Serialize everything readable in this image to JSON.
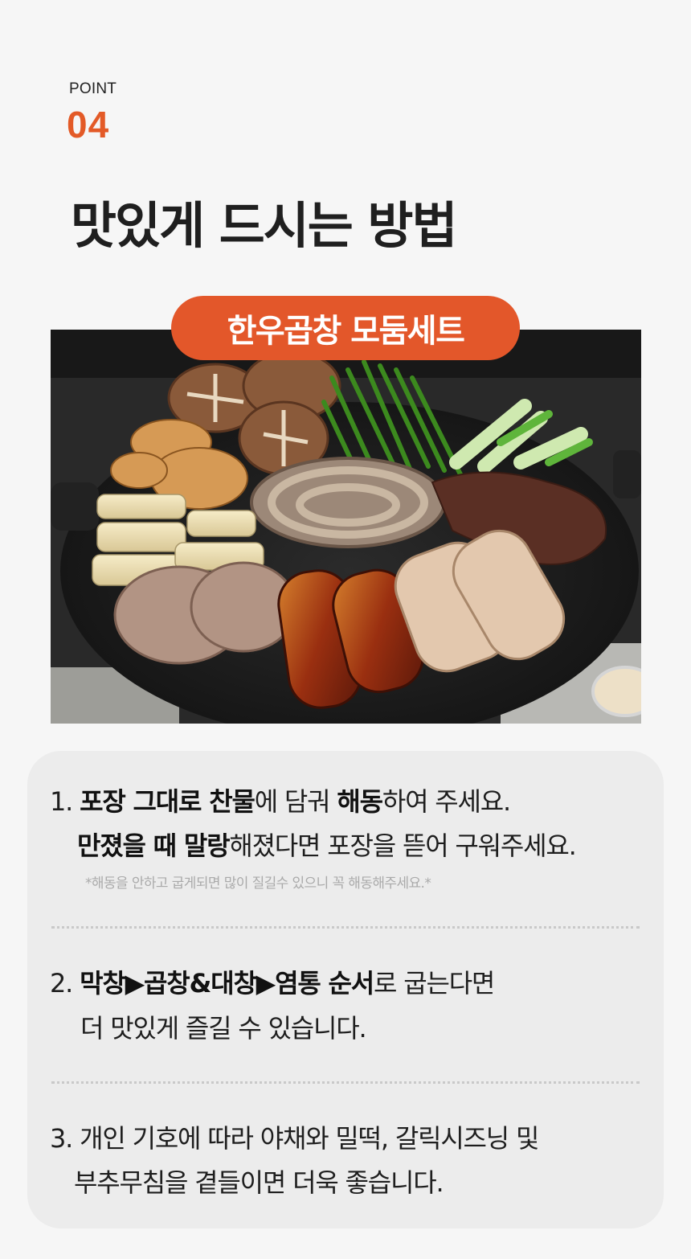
{
  "header": {
    "point_label": "POINT",
    "point_number": "04",
    "title": "맛있게 드시는 방법"
  },
  "product_badge": "한우곱창 모둠세트",
  "steps": [
    {
      "number": "1.",
      "line1": [
        {
          "text": "포장 그대로 찬물",
          "bold": true
        },
        {
          "text": "에 담궈 ",
          "bold": false
        },
        {
          "text": "해동",
          "bold": true
        },
        {
          "text": "하여 주세요.",
          "bold": false
        }
      ],
      "line2": [
        {
          "text": "만졌을 때 말랑",
          "bold": true
        },
        {
          "text": "해졌다면 포장을 뜯어 구워주세요.",
          "bold": false
        }
      ],
      "note": "*해동을 안하고 굽게되면 많이 질길수 있으니 꼭 해동해주세요.*"
    },
    {
      "number": "2.",
      "line1": [
        {
          "text": "막창▶곱창&대창▶염통 순서",
          "bold": true
        },
        {
          "text": "로 굽는다면",
          "bold": false
        }
      ],
      "line2": [
        {
          "text": "더 맛있게 즐길 수 있습니다.",
          "bold": false
        }
      ]
    },
    {
      "number": "3.",
      "line1": [
        {
          "text": "개인 기호에 따라 야채와 밀떡, 갈릭시즈닝 및",
          "bold": false
        }
      ],
      "line2": [
        {
          "text": "부추무침을 곁들이면 더욱 좋습니다.",
          "bold": false
        }
      ]
    }
  ],
  "colors": {
    "accent": "#e3572a",
    "background": "#f6f6f6",
    "card": "#ececec"
  }
}
